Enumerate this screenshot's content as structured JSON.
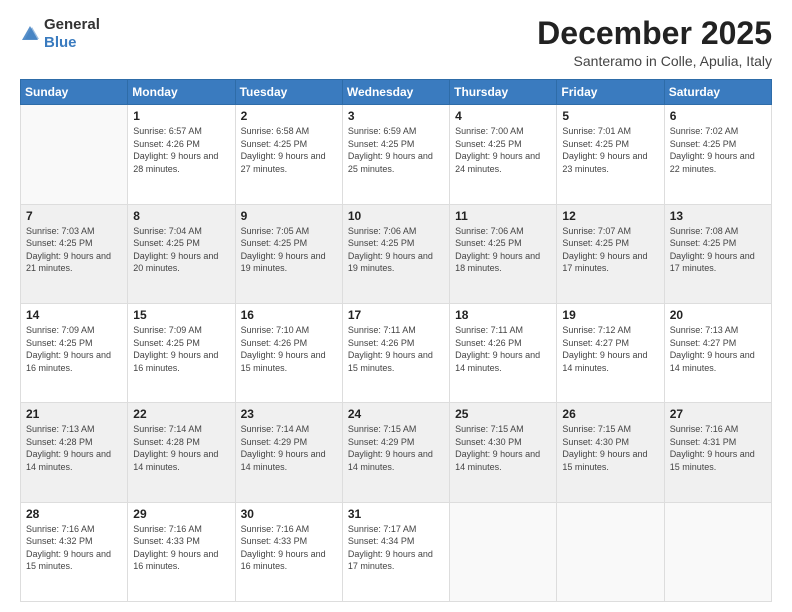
{
  "logo": {
    "general": "General",
    "blue": "Blue"
  },
  "header": {
    "month": "December 2025",
    "location": "Santeramo in Colle, Apulia, Italy"
  },
  "days_of_week": [
    "Sunday",
    "Monday",
    "Tuesday",
    "Wednesday",
    "Thursday",
    "Friday",
    "Saturday"
  ],
  "weeks": [
    [
      {
        "day": "",
        "sunrise": "",
        "sunset": "",
        "daylight": ""
      },
      {
        "day": "1",
        "sunrise": "Sunrise: 6:57 AM",
        "sunset": "Sunset: 4:26 PM",
        "daylight": "Daylight: 9 hours and 28 minutes."
      },
      {
        "day": "2",
        "sunrise": "Sunrise: 6:58 AM",
        "sunset": "Sunset: 4:25 PM",
        "daylight": "Daylight: 9 hours and 27 minutes."
      },
      {
        "day": "3",
        "sunrise": "Sunrise: 6:59 AM",
        "sunset": "Sunset: 4:25 PM",
        "daylight": "Daylight: 9 hours and 25 minutes."
      },
      {
        "day": "4",
        "sunrise": "Sunrise: 7:00 AM",
        "sunset": "Sunset: 4:25 PM",
        "daylight": "Daylight: 9 hours and 24 minutes."
      },
      {
        "day": "5",
        "sunrise": "Sunrise: 7:01 AM",
        "sunset": "Sunset: 4:25 PM",
        "daylight": "Daylight: 9 hours and 23 minutes."
      },
      {
        "day": "6",
        "sunrise": "Sunrise: 7:02 AM",
        "sunset": "Sunset: 4:25 PM",
        "daylight": "Daylight: 9 hours and 22 minutes."
      }
    ],
    [
      {
        "day": "7",
        "sunrise": "Sunrise: 7:03 AM",
        "sunset": "Sunset: 4:25 PM",
        "daylight": "Daylight: 9 hours and 21 minutes."
      },
      {
        "day": "8",
        "sunrise": "Sunrise: 7:04 AM",
        "sunset": "Sunset: 4:25 PM",
        "daylight": "Daylight: 9 hours and 20 minutes."
      },
      {
        "day": "9",
        "sunrise": "Sunrise: 7:05 AM",
        "sunset": "Sunset: 4:25 PM",
        "daylight": "Daylight: 9 hours and 19 minutes."
      },
      {
        "day": "10",
        "sunrise": "Sunrise: 7:06 AM",
        "sunset": "Sunset: 4:25 PM",
        "daylight": "Daylight: 9 hours and 19 minutes."
      },
      {
        "day": "11",
        "sunrise": "Sunrise: 7:06 AM",
        "sunset": "Sunset: 4:25 PM",
        "daylight": "Daylight: 9 hours and 18 minutes."
      },
      {
        "day": "12",
        "sunrise": "Sunrise: 7:07 AM",
        "sunset": "Sunset: 4:25 PM",
        "daylight": "Daylight: 9 hours and 17 minutes."
      },
      {
        "day": "13",
        "sunrise": "Sunrise: 7:08 AM",
        "sunset": "Sunset: 4:25 PM",
        "daylight": "Daylight: 9 hours and 17 minutes."
      }
    ],
    [
      {
        "day": "14",
        "sunrise": "Sunrise: 7:09 AM",
        "sunset": "Sunset: 4:25 PM",
        "daylight": "Daylight: 9 hours and 16 minutes."
      },
      {
        "day": "15",
        "sunrise": "Sunrise: 7:09 AM",
        "sunset": "Sunset: 4:25 PM",
        "daylight": "Daylight: 9 hours and 16 minutes."
      },
      {
        "day": "16",
        "sunrise": "Sunrise: 7:10 AM",
        "sunset": "Sunset: 4:26 PM",
        "daylight": "Daylight: 9 hours and 15 minutes."
      },
      {
        "day": "17",
        "sunrise": "Sunrise: 7:11 AM",
        "sunset": "Sunset: 4:26 PM",
        "daylight": "Daylight: 9 hours and 15 minutes."
      },
      {
        "day": "18",
        "sunrise": "Sunrise: 7:11 AM",
        "sunset": "Sunset: 4:26 PM",
        "daylight": "Daylight: 9 hours and 14 minutes."
      },
      {
        "day": "19",
        "sunrise": "Sunrise: 7:12 AM",
        "sunset": "Sunset: 4:27 PM",
        "daylight": "Daylight: 9 hours and 14 minutes."
      },
      {
        "day": "20",
        "sunrise": "Sunrise: 7:13 AM",
        "sunset": "Sunset: 4:27 PM",
        "daylight": "Daylight: 9 hours and 14 minutes."
      }
    ],
    [
      {
        "day": "21",
        "sunrise": "Sunrise: 7:13 AM",
        "sunset": "Sunset: 4:28 PM",
        "daylight": "Daylight: 9 hours and 14 minutes."
      },
      {
        "day": "22",
        "sunrise": "Sunrise: 7:14 AM",
        "sunset": "Sunset: 4:28 PM",
        "daylight": "Daylight: 9 hours and 14 minutes."
      },
      {
        "day": "23",
        "sunrise": "Sunrise: 7:14 AM",
        "sunset": "Sunset: 4:29 PM",
        "daylight": "Daylight: 9 hours and 14 minutes."
      },
      {
        "day": "24",
        "sunrise": "Sunrise: 7:15 AM",
        "sunset": "Sunset: 4:29 PM",
        "daylight": "Daylight: 9 hours and 14 minutes."
      },
      {
        "day": "25",
        "sunrise": "Sunrise: 7:15 AM",
        "sunset": "Sunset: 4:30 PM",
        "daylight": "Daylight: 9 hours and 14 minutes."
      },
      {
        "day": "26",
        "sunrise": "Sunrise: 7:15 AM",
        "sunset": "Sunset: 4:30 PM",
        "daylight": "Daylight: 9 hours and 15 minutes."
      },
      {
        "day": "27",
        "sunrise": "Sunrise: 7:16 AM",
        "sunset": "Sunset: 4:31 PM",
        "daylight": "Daylight: 9 hours and 15 minutes."
      }
    ],
    [
      {
        "day": "28",
        "sunrise": "Sunrise: 7:16 AM",
        "sunset": "Sunset: 4:32 PM",
        "daylight": "Daylight: 9 hours and 15 minutes."
      },
      {
        "day": "29",
        "sunrise": "Sunrise: 7:16 AM",
        "sunset": "Sunset: 4:33 PM",
        "daylight": "Daylight: 9 hours and 16 minutes."
      },
      {
        "day": "30",
        "sunrise": "Sunrise: 7:16 AM",
        "sunset": "Sunset: 4:33 PM",
        "daylight": "Daylight: 9 hours and 16 minutes."
      },
      {
        "day": "31",
        "sunrise": "Sunrise: 7:17 AM",
        "sunset": "Sunset: 4:34 PM",
        "daylight": "Daylight: 9 hours and 17 minutes."
      },
      {
        "day": "",
        "sunrise": "",
        "sunset": "",
        "daylight": ""
      },
      {
        "day": "",
        "sunrise": "",
        "sunset": "",
        "daylight": ""
      },
      {
        "day": "",
        "sunrise": "",
        "sunset": "",
        "daylight": ""
      }
    ]
  ]
}
